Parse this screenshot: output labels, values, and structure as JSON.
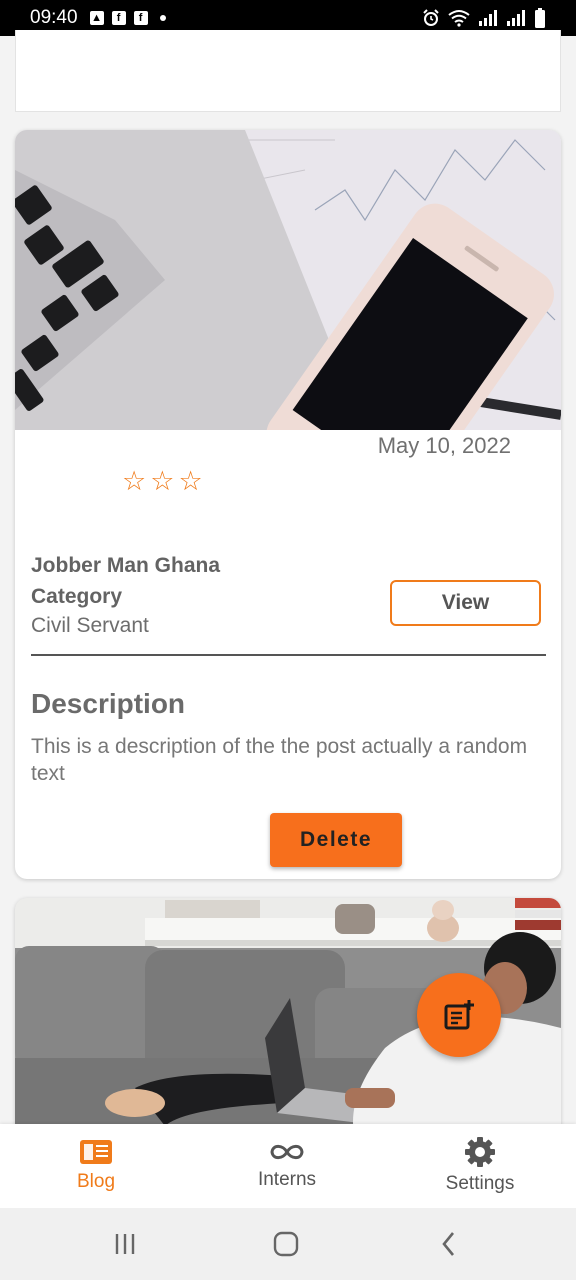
{
  "status_bar": {
    "time": "09:40",
    "icons_left": [
      "image-icon",
      "facebook-icon",
      "facebook-icon",
      "dot-icon"
    ],
    "icons_right": [
      "alarm-icon",
      "wifi-icon",
      "signal-icon",
      "signal-icon",
      "battery-icon"
    ]
  },
  "posts": [
    {
      "image": "laptop-phone-desk-photo",
      "date": "May 10, 2022",
      "rating_stars": 3,
      "company": "Jobber Man Ghana",
      "category_label": "Category",
      "category": "Civil Servant",
      "view_label": "View",
      "description_title": "Description",
      "description": "This is a description of the the post actually a random text",
      "delete_label": "Delete"
    },
    {
      "image": "woman-couch-laptop-photo"
    }
  ],
  "fab": {
    "icon": "add-note-icon"
  },
  "bottom_nav": {
    "items": [
      {
        "label": "Blog",
        "icon": "article-icon",
        "active": true
      },
      {
        "label": "Interns",
        "icon": "infinity-icon",
        "active": false
      },
      {
        "label": "Settings",
        "icon": "gear-icon",
        "active": false
      }
    ]
  },
  "colors": {
    "accent": "#f07b1a",
    "button_orange": "#f76f1c",
    "text_gray": "#636363"
  }
}
